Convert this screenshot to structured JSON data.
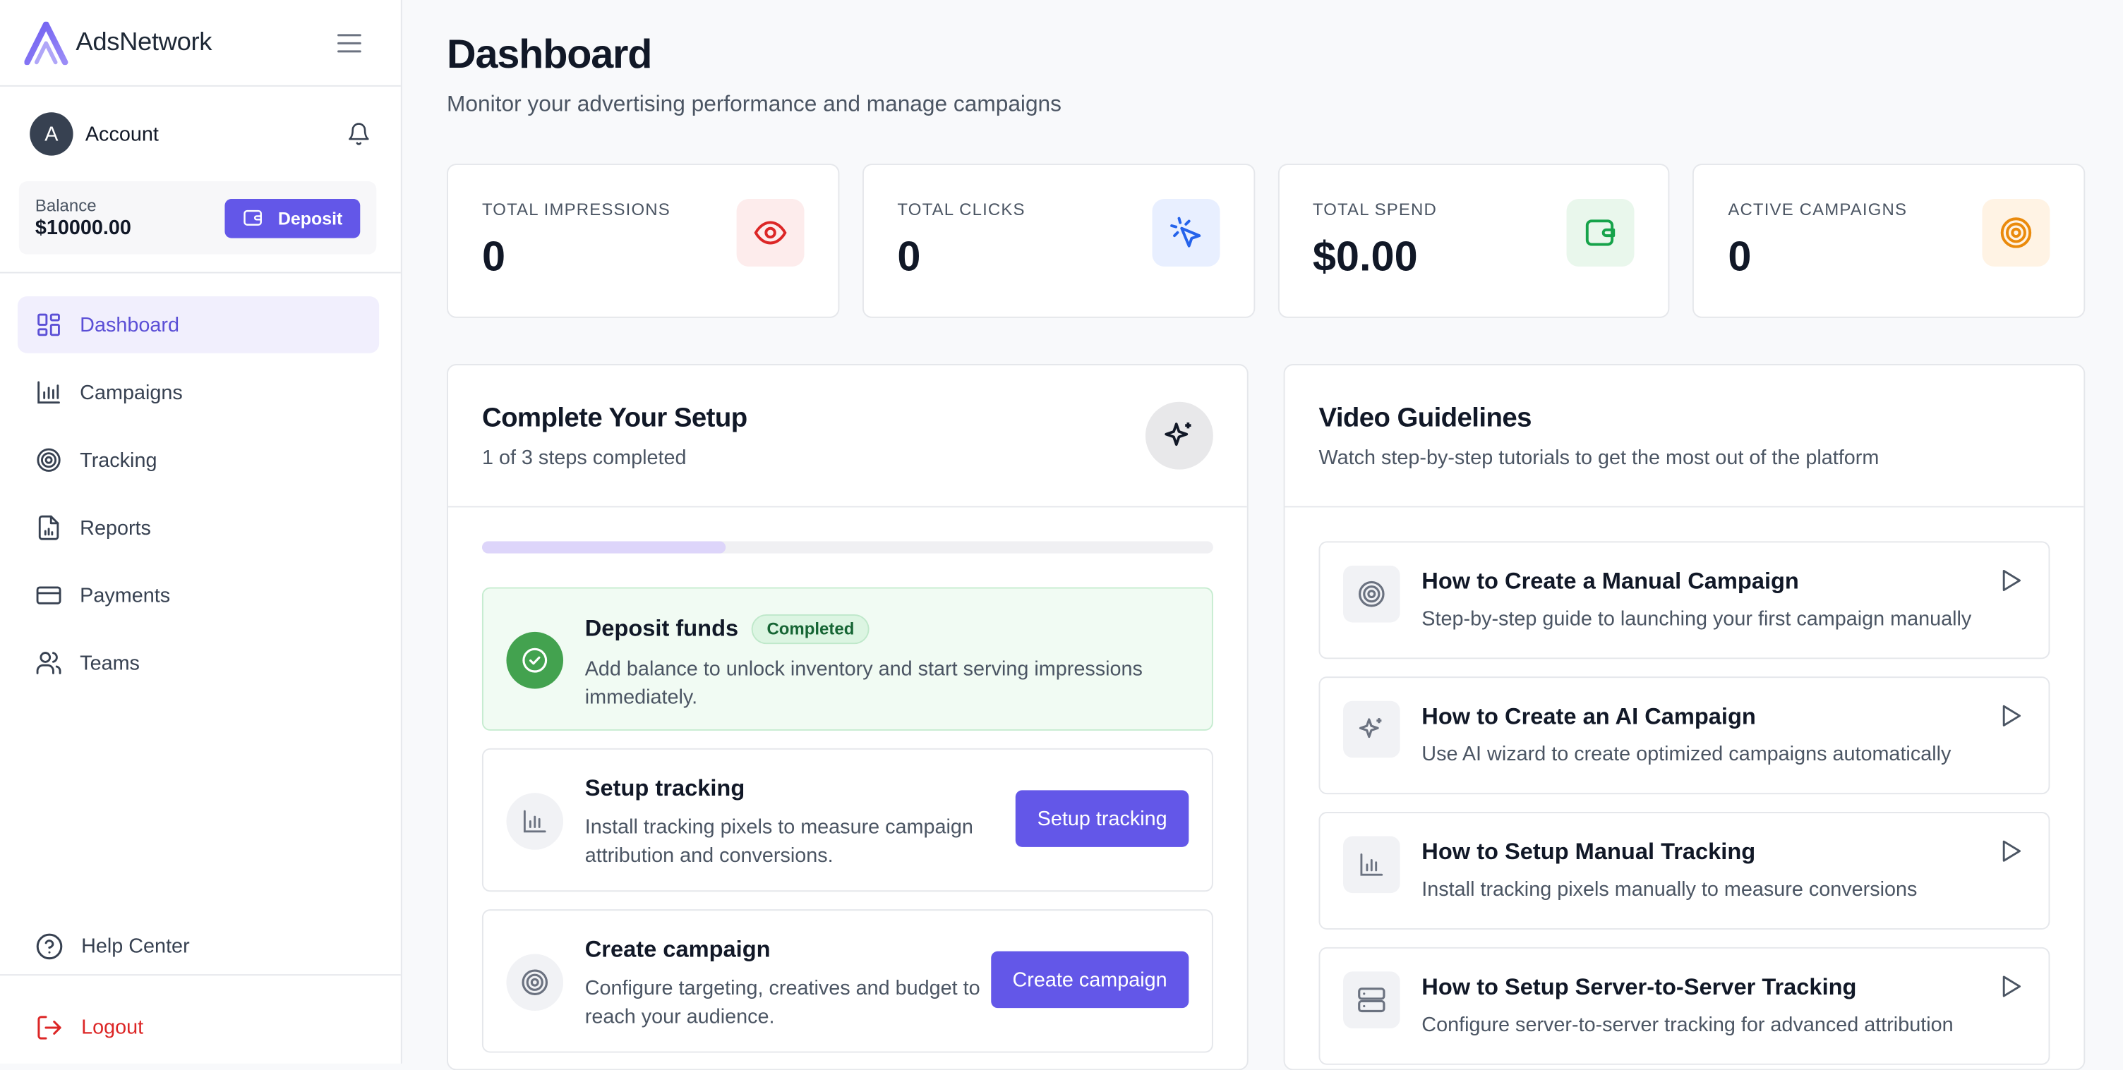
{
  "brand": {
    "name": "AdsNetwork",
    "accent": "#6357e8"
  },
  "account": {
    "initial": "A",
    "name": "Account"
  },
  "balance": {
    "label": "Balance",
    "value": "$10000.00",
    "deposit_label": "Deposit"
  },
  "nav": {
    "items": [
      {
        "label": "Dashboard",
        "icon": "grid-icon"
      },
      {
        "label": "Campaigns",
        "icon": "bar-chart-icon"
      },
      {
        "label": "Tracking",
        "icon": "target-icon"
      },
      {
        "label": "Reports",
        "icon": "report-icon"
      },
      {
        "label": "Payments",
        "icon": "card-icon"
      },
      {
        "label": "Teams",
        "icon": "users-icon"
      }
    ],
    "active": "Dashboard",
    "help": "Help Center",
    "logout": "Logout"
  },
  "page": {
    "title": "Dashboard",
    "subtitle": "Monitor your advertising performance and manage campaigns"
  },
  "stats": [
    {
      "label": "TOTAL IMPRESSIONS",
      "value": "0",
      "icon": "eye-icon",
      "color": "#dc2626"
    },
    {
      "label": "TOTAL CLICKS",
      "value": "0",
      "icon": "cursor-click-icon",
      "color": "#2563eb"
    },
    {
      "label": "TOTAL SPEND",
      "value": "$0.00",
      "icon": "wallet-icon",
      "color": "#16a34a"
    },
    {
      "label": "ACTIVE CAMPAIGNS",
      "value": "0",
      "icon": "target-icon",
      "color": "#ea8a0c"
    }
  ],
  "setup": {
    "title": "Complete Your Setup",
    "subtitle": "1 of 3 steps completed",
    "progress": 0.333,
    "steps": [
      {
        "title": "Deposit funds",
        "badge": "Completed",
        "desc": "Add balance to unlock inventory and start serving impressions immediately."
      },
      {
        "title": "Setup tracking",
        "desc": "Install tracking pixels to measure campaign attribution and conversions.",
        "button": "Setup tracking"
      },
      {
        "title": "Create campaign",
        "desc": "Configure targeting, creatives and budget to reach your audience.",
        "button": "Create campaign"
      }
    ]
  },
  "videos": {
    "title": "Video Guidelines",
    "subtitle": "Watch step-by-step tutorials to get the most out of the platform",
    "items": [
      {
        "title": "How to Create a Manual Campaign",
        "desc": "Step-by-step guide to launching your first campaign manually",
        "icon": "target-icon"
      },
      {
        "title": "How to Create an AI Campaign",
        "desc": "Use AI wizard to create optimized campaigns automatically",
        "icon": "sparkles-icon"
      },
      {
        "title": "How to Setup Manual Tracking",
        "desc": "Install tracking pixels manually to measure conversions",
        "icon": "bar-chart-icon"
      },
      {
        "title": "How to Setup Server-to-Server Tracking",
        "desc": "Configure server-to-server tracking for advanced attribution",
        "icon": "server-icon"
      }
    ]
  }
}
